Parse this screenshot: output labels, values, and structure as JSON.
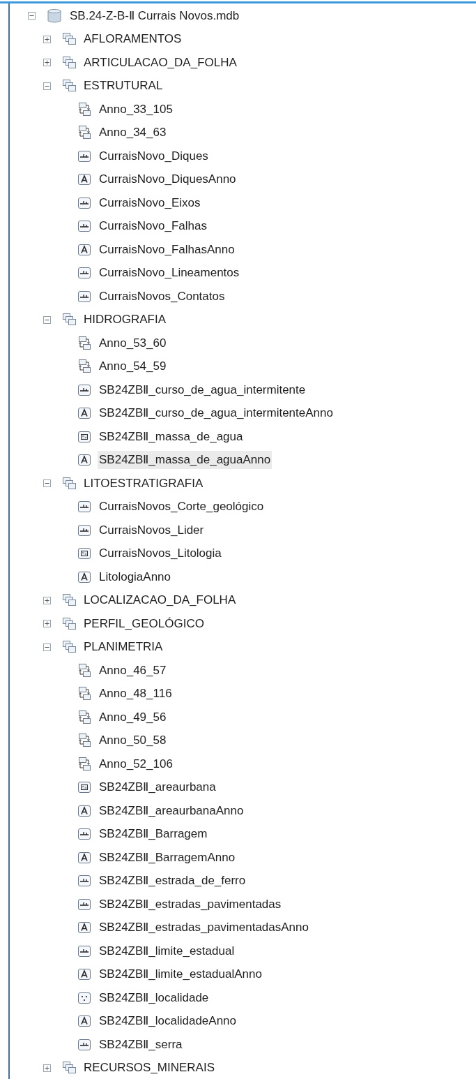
{
  "tree": {
    "name": "SB.24-Z-B-Ⅱ Currais Novos.mdb",
    "kind": "database",
    "expanded": true,
    "selected": false,
    "children": [
      {
        "name": "AFLORAMENTOS",
        "kind": "dataset",
        "expanded": false,
        "selected": false
      },
      {
        "name": "ARTICULACAO_DA_FOLHA",
        "kind": "dataset",
        "expanded": false,
        "selected": false
      },
      {
        "name": "ESTRUTURAL",
        "kind": "dataset",
        "expanded": true,
        "selected": false,
        "children": [
          {
            "name": "Anno_33_105",
            "kind": "relationship",
            "selected": false
          },
          {
            "name": "Anno_34_63",
            "kind": "relationship",
            "selected": false
          },
          {
            "name": "CurraisNovo_Diques",
            "kind": "line",
            "selected": false
          },
          {
            "name": "CurraisNovo_DiquesAnno",
            "kind": "annotation",
            "selected": false
          },
          {
            "name": "CurraisNovo_Eixos",
            "kind": "line",
            "selected": false
          },
          {
            "name": "CurraisNovo_Falhas",
            "kind": "line",
            "selected": false
          },
          {
            "name": "CurraisNovo_FalhasAnno",
            "kind": "annotation",
            "selected": false
          },
          {
            "name": "CurraisNovo_Lineamentos",
            "kind": "line",
            "selected": false
          },
          {
            "name": "CurraisNovos_Contatos",
            "kind": "line",
            "selected": false
          }
        ]
      },
      {
        "name": "HIDROGRAFIA",
        "kind": "dataset",
        "expanded": true,
        "selected": false,
        "children": [
          {
            "name": "Anno_53_60",
            "kind": "relationship",
            "selected": false
          },
          {
            "name": "Anno_54_59",
            "kind": "relationship",
            "selected": false
          },
          {
            "name": "SB24ZBⅡ_curso_de_agua_intermitente",
            "kind": "line",
            "selected": false
          },
          {
            "name": "SB24ZBⅡ_curso_de_agua_intermitenteAnno",
            "kind": "annotation",
            "selected": false
          },
          {
            "name": "SB24ZBⅡ_massa_de_agua",
            "kind": "polygon",
            "selected": false
          },
          {
            "name": "SB24ZBⅡ_massa_de_aguaAnno",
            "kind": "annotation",
            "selected": true
          }
        ]
      },
      {
        "name": "LITOESTRATIGRAFIA",
        "kind": "dataset",
        "expanded": true,
        "selected": false,
        "children": [
          {
            "name": "CurraisNovos_Corte_geológico",
            "kind": "line",
            "selected": false
          },
          {
            "name": "CurraisNovos_Lider",
            "kind": "line",
            "selected": false
          },
          {
            "name": "CurraisNovos_Litologia",
            "kind": "polygon",
            "selected": false
          },
          {
            "name": "LitologiaAnno",
            "kind": "annotation",
            "selected": false
          }
        ]
      },
      {
        "name": "LOCALIZACAO_DA_FOLHA",
        "kind": "dataset",
        "expanded": false,
        "selected": false
      },
      {
        "name": "PERFIL_GEOLÓGICO",
        "kind": "dataset",
        "expanded": false,
        "selected": false
      },
      {
        "name": "PLANIMETRIA",
        "kind": "dataset",
        "expanded": true,
        "selected": false,
        "children": [
          {
            "name": "Anno_46_57",
            "kind": "relationship",
            "selected": false
          },
          {
            "name": "Anno_48_116",
            "kind": "relationship",
            "selected": false
          },
          {
            "name": "Anno_49_56",
            "kind": "relationship",
            "selected": false
          },
          {
            "name": "Anno_50_58",
            "kind": "relationship",
            "selected": false
          },
          {
            "name": "Anno_52_106",
            "kind": "relationship",
            "selected": false
          },
          {
            "name": "SB24ZBⅡ_areaurbana",
            "kind": "polygon",
            "selected": false
          },
          {
            "name": "SB24ZBⅡ_areaurbanaAnno",
            "kind": "annotation",
            "selected": false
          },
          {
            "name": "SB24ZBⅡ_Barragem",
            "kind": "line",
            "selected": false
          },
          {
            "name": "SB24ZBⅡ_BarragemAnno",
            "kind": "annotation",
            "selected": false
          },
          {
            "name": "SB24ZBⅡ_estrada_de_ferro",
            "kind": "line",
            "selected": false
          },
          {
            "name": "SB24ZBⅡ_estradas_pavimentadas",
            "kind": "line",
            "selected": false
          },
          {
            "name": "SB24ZBⅡ_estradas_pavimentadasAnno",
            "kind": "annotation",
            "selected": false
          },
          {
            "name": "SB24ZBⅡ_limite_estadual",
            "kind": "line",
            "selected": false
          },
          {
            "name": "SB24ZBⅡ_limite_estadualAnno",
            "kind": "annotation",
            "selected": false
          },
          {
            "name": "SB24ZBⅡ_localidade",
            "kind": "point",
            "selected": false
          },
          {
            "name": "SB24ZBⅡ_localidadeAnno",
            "kind": "annotation",
            "selected": false
          },
          {
            "name": "SB24ZBⅡ_serra",
            "kind": "line",
            "selected": false
          }
        ]
      },
      {
        "name": "RECURSOS_MINERAIS",
        "kind": "dataset",
        "expanded": false,
        "selected": false
      }
    ]
  }
}
